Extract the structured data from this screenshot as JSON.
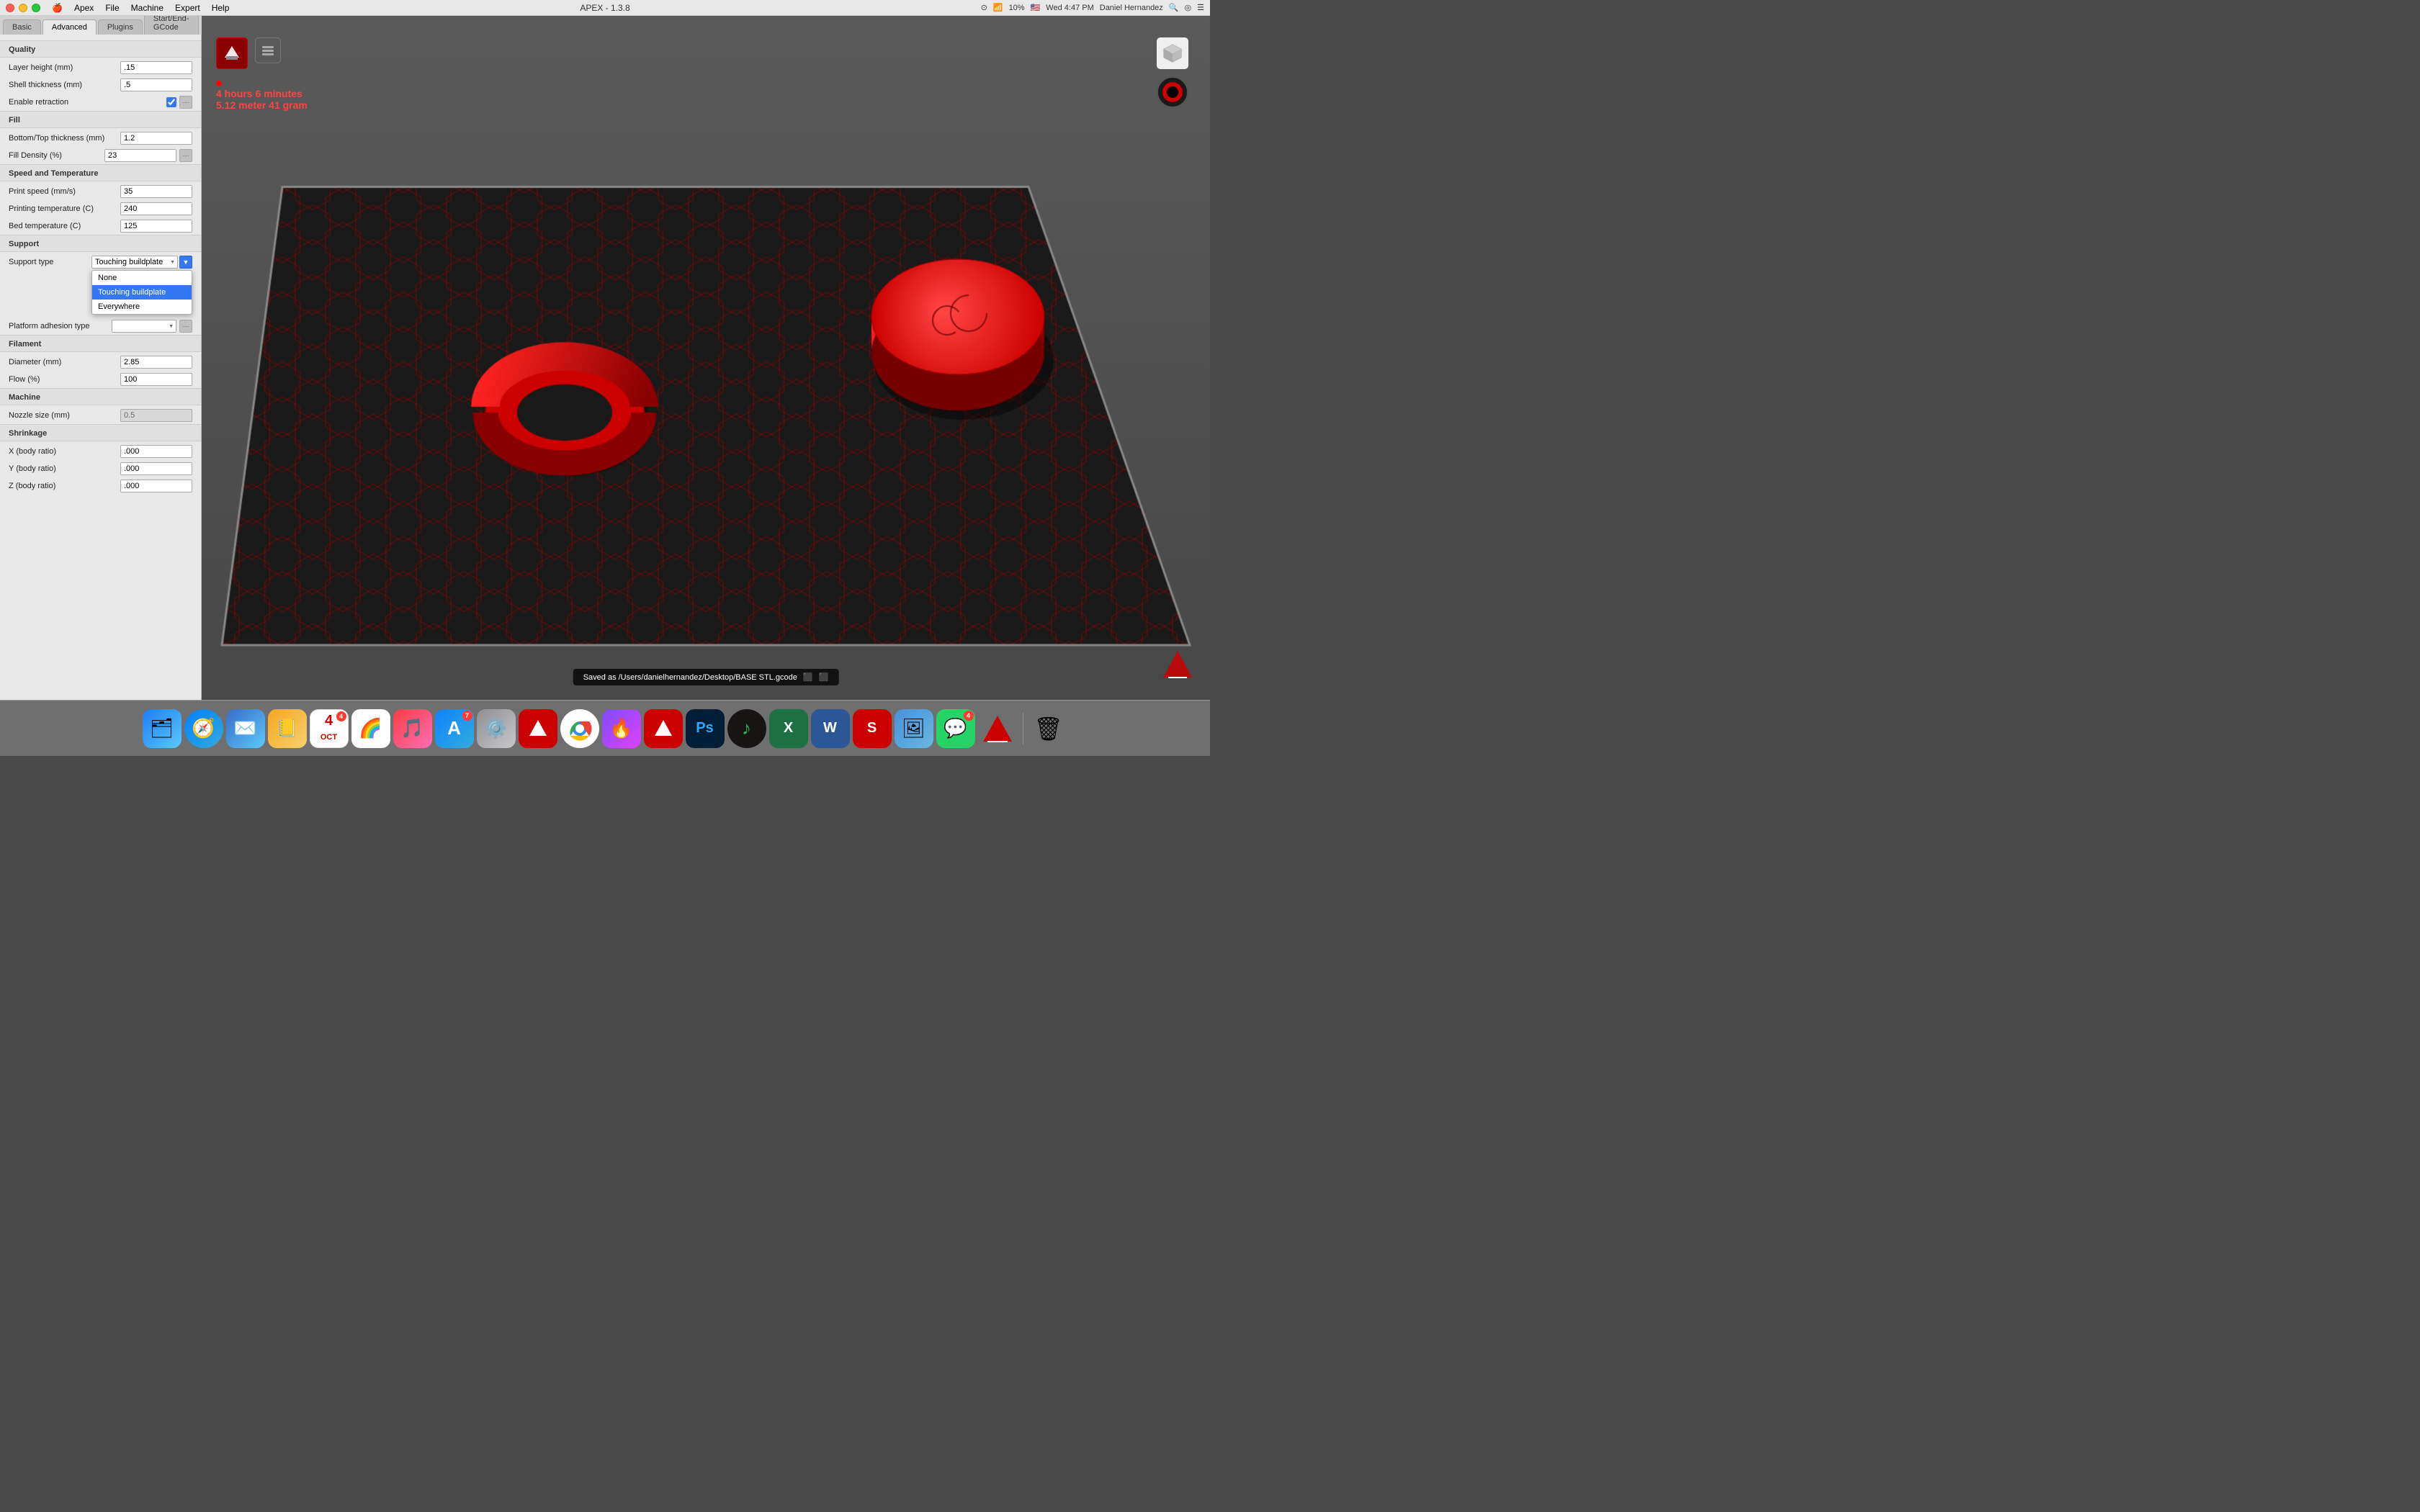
{
  "menubar": {
    "apple": "⌘",
    "items": [
      "Apex",
      "File",
      "Machine",
      "Expert",
      "Help"
    ],
    "title": "APEX - 1.3.8",
    "right": {
      "icons": [
        "🔍",
        "👁",
        "📶",
        "🔋"
      ],
      "battery": "10%",
      "flag": "🇺🇸",
      "time": "Wed 4:47 PM",
      "user": "Daniel Hernandez",
      "search": "🔍",
      "siri": "◎",
      "menu": "☰"
    }
  },
  "tabs": [
    {
      "label": "Basic",
      "active": false
    },
    {
      "label": "Advanced",
      "active": true
    },
    {
      "label": "Plugins",
      "active": false
    },
    {
      "label": "Start/End-GCode",
      "active": false
    }
  ],
  "settings": {
    "quality": {
      "header": "Quality",
      "layer_height_label": "Layer height (mm)",
      "layer_height_value": ".15",
      "shell_thickness_label": "Shell thickness (mm)",
      "shell_thickness_value": ".5",
      "enable_retraction_label": "Enable retraction",
      "enable_retraction_checked": true
    },
    "fill": {
      "header": "Fill",
      "bottom_top_label": "Bottom/Top thickness (mm)",
      "bottom_top_value": "1.2",
      "fill_density_label": "Fill Density (%)",
      "fill_density_value": "23"
    },
    "speed": {
      "header": "Speed and Temperature",
      "print_speed_label": "Print speed (mm/s)",
      "print_speed_value": "35",
      "print_temp_label": "Printing temperature (C)",
      "print_temp_value": "240",
      "bed_temp_label": "Bed temperature (C)",
      "bed_temp_value": "125"
    },
    "support": {
      "header": "Support",
      "support_type_label": "Support type",
      "support_type_value": "Touching buildplate",
      "platform_adhesion_label": "Platform adhesion type",
      "dropdown_options": [
        "None",
        "Touching buildplate",
        "Everywhere"
      ]
    },
    "filament": {
      "header": "Filament",
      "diameter_label": "Diameter (mm)",
      "diameter_value": "2.85",
      "flow_label": "Flow (%)",
      "flow_value": "100"
    },
    "machine": {
      "header": "Machine",
      "nozzle_label": "Nozzle size (mm)",
      "nozzle_value": "0.5"
    },
    "shrinkage": {
      "header": "Shrinkage",
      "x_label": "X (body ratio)",
      "x_value": ".000",
      "y_label": "Y (body ratio)",
      "y_value": ".000",
      "z_label": "Z (body ratio)",
      "z_value": ".000"
    }
  },
  "viewport": {
    "print_time": "4 hours 6 minutes",
    "print_material": "5.12 meter 41 gram",
    "status_message": "Saved as /Users/danielhernandez/Desktop/BASE STL.gcode"
  },
  "dock": {
    "items": [
      {
        "name": "finder",
        "icon": "🗂",
        "color": "#1a7ef7"
      },
      {
        "name": "safari",
        "icon": "🧭",
        "color": "#0080ff"
      },
      {
        "name": "mail",
        "icon": "✉️",
        "color": "#4a90d9"
      },
      {
        "name": "contacts",
        "icon": "📒",
        "color": "#f5a623"
      },
      {
        "name": "calendar",
        "icon": "📅",
        "color": "#ff3b30",
        "badge": "4"
      },
      {
        "name": "photos",
        "icon": "🌈",
        "color": "#ff9500"
      },
      {
        "name": "itunes",
        "icon": "🎵",
        "color": "#fc3c44"
      },
      {
        "name": "app-store",
        "icon": "🅐",
        "color": "#0d84ff",
        "badge": "7"
      },
      {
        "name": "system-prefs",
        "icon": "⚙️",
        "color": "#8e8e93"
      },
      {
        "name": "cura",
        "icon": "▲",
        "color": "#cc0000"
      },
      {
        "name": "chrome",
        "icon": "●",
        "color": "#4285f4"
      },
      {
        "name": "torchbrowser",
        "icon": "🔥",
        "color": "#7c4dff"
      },
      {
        "name": "autodesk",
        "icon": "▲",
        "color": "#cc0000"
      },
      {
        "name": "photoshop",
        "icon": "Ps",
        "color": "#001e36"
      },
      {
        "name": "spotify",
        "icon": "♪",
        "color": "#1db954"
      },
      {
        "name": "excel",
        "icon": "X",
        "color": "#1d7044"
      },
      {
        "name": "word",
        "icon": "W",
        "color": "#2b5797"
      },
      {
        "name": "sketchup",
        "icon": "S",
        "color": "#cc0000"
      },
      {
        "name": "preview",
        "icon": "🖼",
        "color": "#4a90d9"
      },
      {
        "name": "whatsapp",
        "icon": "💬",
        "color": "#25d366",
        "badge": "4"
      },
      {
        "name": "apex-red",
        "icon": "▲",
        "color": "#cc0000"
      },
      {
        "name": "trash",
        "icon": "🗑",
        "color": "#8e8e93"
      }
    ]
  }
}
